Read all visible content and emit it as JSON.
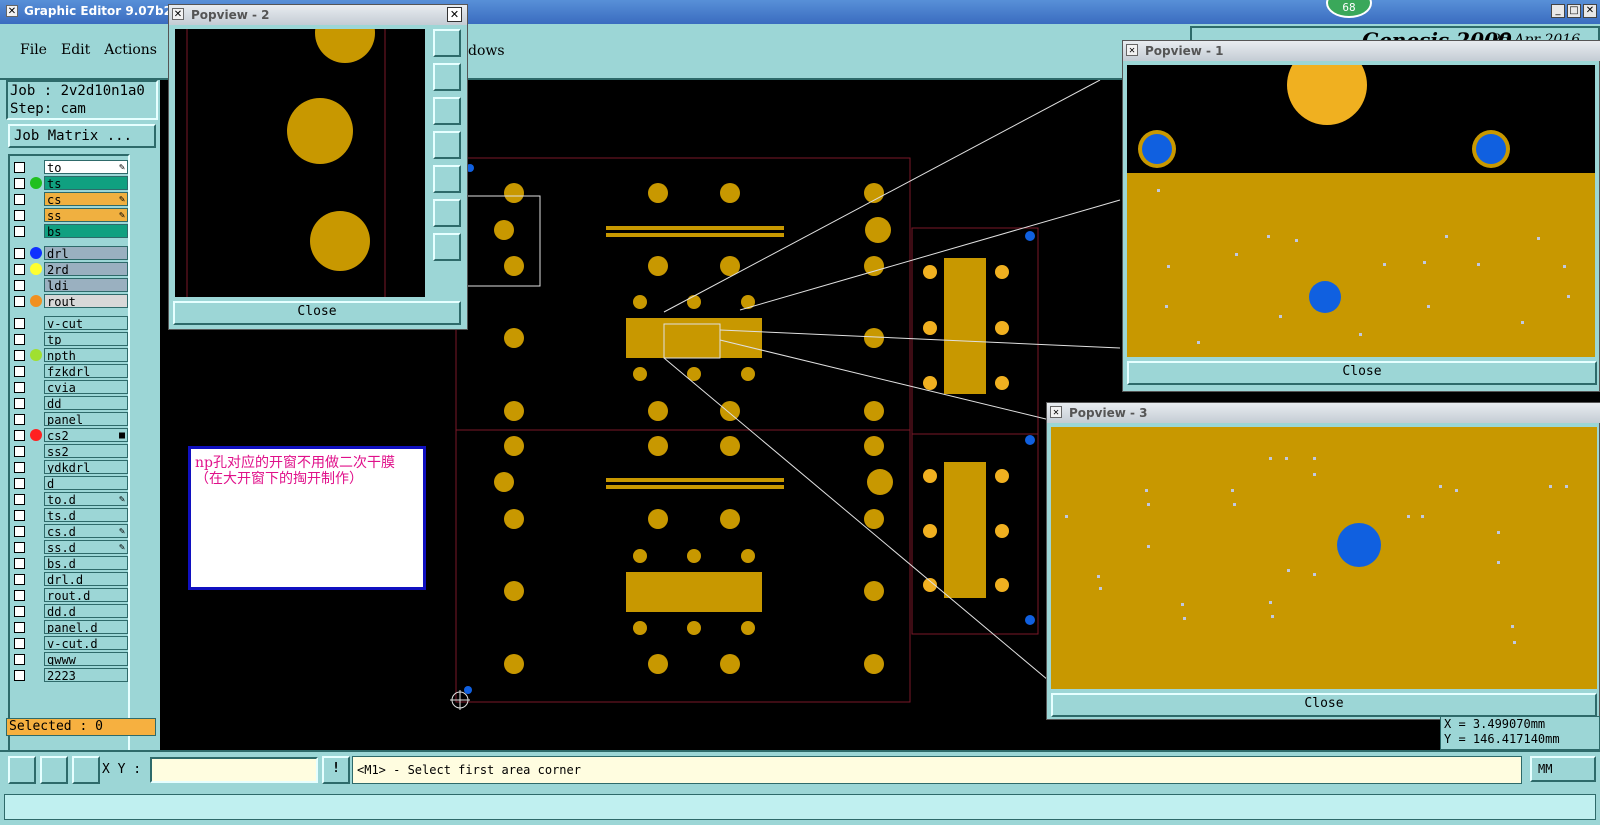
{
  "window": {
    "title": "Graphic Editor 9.07b2 (00",
    "badge": "68"
  },
  "menu": {
    "file": "File",
    "edit": "Edit",
    "actions": "Actions",
    "windows_fragment": "dows"
  },
  "brand": {
    "text": "Genesis 2000",
    "date": "25 Apr 2016"
  },
  "job": {
    "job_line": "Job : 2v2d10n1a0",
    "step_line": "Step: cam",
    "matrix_button": "Job Matrix ..."
  },
  "layers": [
    {
      "name": "to",
      "bg": "#ffffff",
      "dot": "",
      "mark": "✎"
    },
    {
      "name": "ts",
      "bg": "#10a080",
      "dot": "#20c020",
      "mark": ""
    },
    {
      "name": "cs",
      "bg": "#f0b040",
      "dot": "",
      "mark": "✎"
    },
    {
      "name": "ss",
      "bg": "#f0b040",
      "dot": "",
      "mark": "✎"
    },
    {
      "name": "bs",
      "bg": "#10a080",
      "dot": "",
      "mark": ""
    },
    {
      "name": "drl",
      "bg": "#9ab0c0",
      "dot": "#1030ff",
      "mark": ""
    },
    {
      "name": "2rd",
      "bg": "#9ab0c0",
      "dot": "#ffff30",
      "mark": ""
    },
    {
      "name": "ldi",
      "bg": "#9ab0c0",
      "dot": "",
      "mark": ""
    },
    {
      "name": "rout",
      "bg": "#d8d8d8",
      "dot": "#f09020",
      "mark": ""
    },
    {
      "name": "v-cut",
      "bg": "#9cd6d6",
      "dot": "",
      "mark": ""
    },
    {
      "name": "tp",
      "bg": "#9cd6d6",
      "dot": "",
      "mark": ""
    },
    {
      "name": "npth",
      "bg": "#9cd6d6",
      "dot": "#a0e030",
      "mark": ""
    },
    {
      "name": "fzkdrl",
      "bg": "#9cd6d6",
      "dot": "",
      "mark": ""
    },
    {
      "name": "cvia",
      "bg": "#9cd6d6",
      "dot": "",
      "mark": ""
    },
    {
      "name": "dd",
      "bg": "#9cd6d6",
      "dot": "",
      "mark": ""
    },
    {
      "name": "panel",
      "bg": "#9cd6d6",
      "dot": "",
      "mark": ""
    },
    {
      "name": "cs2",
      "bg": "#9cd6d6",
      "dot": "#ff2020",
      "mark": "■"
    },
    {
      "name": "ss2",
      "bg": "#9cd6d6",
      "dot": "",
      "mark": ""
    },
    {
      "name": "ydkdrl",
      "bg": "#9cd6d6",
      "dot": "",
      "mark": ""
    },
    {
      "name": "d",
      "bg": "#9cd6d6",
      "dot": "",
      "mark": ""
    },
    {
      "name": "to.d",
      "bg": "#9cd6d6",
      "dot": "",
      "mark": "✎"
    },
    {
      "name": "ts.d",
      "bg": "#9cd6d6",
      "dot": "",
      "mark": ""
    },
    {
      "name": "cs.d",
      "bg": "#9cd6d6",
      "dot": "",
      "mark": "✎"
    },
    {
      "name": "ss.d",
      "bg": "#9cd6d6",
      "dot": "",
      "mark": "✎"
    },
    {
      "name": "bs.d",
      "bg": "#9cd6d6",
      "dot": "",
      "mark": ""
    },
    {
      "name": "drl.d",
      "bg": "#9cd6d6",
      "dot": "",
      "mark": ""
    },
    {
      "name": "rout.d",
      "bg": "#9cd6d6",
      "dot": "",
      "mark": ""
    },
    {
      "name": "dd.d",
      "bg": "#9cd6d6",
      "dot": "",
      "mark": ""
    },
    {
      "name": "panel.d",
      "bg": "#9cd6d6",
      "dot": "",
      "mark": ""
    },
    {
      "name": "v-cut.d",
      "bg": "#9cd6d6",
      "dot": "",
      "mark": ""
    },
    {
      "name": "qwww",
      "bg": "#9cd6d6",
      "dot": "",
      "mark": ""
    },
    {
      "name": "2223",
      "bg": "#9cd6d6",
      "dot": "",
      "mark": ""
    }
  ],
  "selected": "Selected : 0",
  "note": {
    "text": "np孔对应的开窗不用做二次干膜（在大开窗下的掏开制作）"
  },
  "popview1": {
    "title": "Popview - 1",
    "close": "Close"
  },
  "popview2": {
    "title": "Popview - 2",
    "close": "Close"
  },
  "popview3": {
    "title": "Popview - 3",
    "close": "Close"
  },
  "coords": {
    "x": "X =   3.499070mm",
    "y": "Y = 146.417140mm"
  },
  "statusbar": {
    "xy_label": "X Y :",
    "xy_value": "",
    "prompt": "<M1> - Select first area corner",
    "units": "MM"
  },
  "colors": {
    "pad_gold": "#c89800",
    "panel_teal": "#9cd6d6",
    "note_text": "#e0108a",
    "hole_blue": "#1060e0"
  }
}
